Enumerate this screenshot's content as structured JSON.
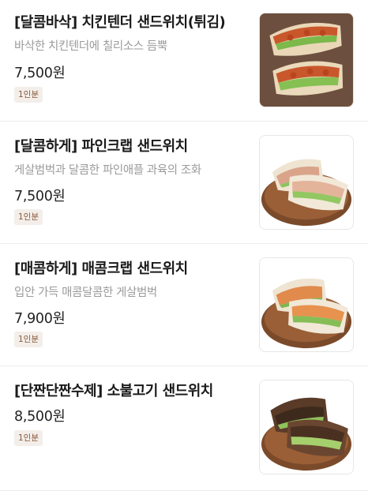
{
  "menu": [
    {
      "title": "[달콤바삭] 치킨텐더 샌드위치(튀김)",
      "description": "바삭한 치킨텐더에 칠리소스 듬뿍",
      "price": "7,500원",
      "badge": "1인분",
      "image_icon": "chicken-tender-sandwich-photo"
    },
    {
      "title": "[달콤하게] 파인크랩 샌드위치",
      "description": "게살범벅과 달콤한 파인애플 과육의 조화",
      "price": "7,500원",
      "badge": "1인분",
      "image_icon": "pine-crab-sandwich-photo"
    },
    {
      "title": "[매콤하게] 매콤크랩 샌드위치",
      "description": "입안 가득 매콤달콤한 게살범벅",
      "price": "7,900원",
      "badge": "1인분",
      "image_icon": "spicy-crab-sandwich-photo"
    },
    {
      "title": "[단짠단짠수제] 소불고기 샌드위치",
      "description": "",
      "price": "8,500원",
      "badge": "1인분",
      "image_icon": "bulgogi-sandwich-photo"
    }
  ],
  "colors": {
    "badge_bg": "#f3eee9",
    "badge_text": "#8b5a3c",
    "divider": "#ececec"
  }
}
